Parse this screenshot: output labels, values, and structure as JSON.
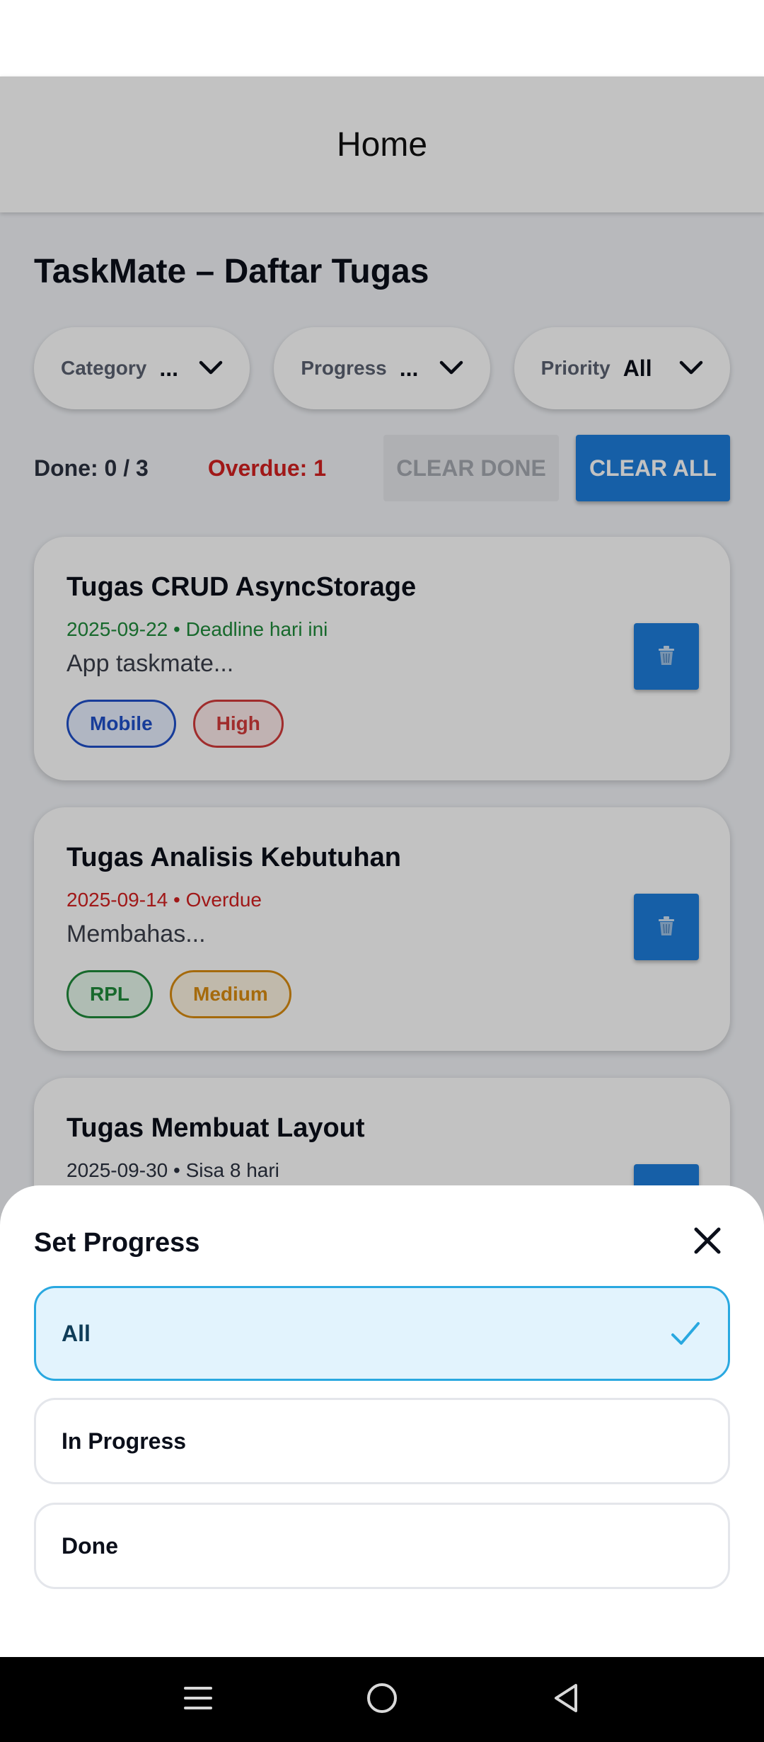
{
  "header": {
    "title": "Home"
  },
  "page": {
    "title": "TaskMate – Daftar Tugas"
  },
  "filters": [
    {
      "label": "Category",
      "value": "..."
    },
    {
      "label": "Progress",
      "value": "..."
    },
    {
      "label": "Priority",
      "value": "All"
    }
  ],
  "stats": {
    "done": "Done: 0 / 3",
    "overdue": "Overdue: 1",
    "clear_done_label": "CLEAR DONE",
    "clear_all_label": "CLEAR ALL"
  },
  "tasks": [
    {
      "title": "Tugas CRUD AsyncStorage",
      "meta": "2025-09-22 • Deadline hari ini",
      "meta_color": "#1f8a3b",
      "description": "App taskmate...",
      "tags": [
        {
          "label": "Mobile",
          "color": "#1f4fc9",
          "bg": "#e8efff"
        },
        {
          "label": "High",
          "color": "#d33a3a",
          "bg": "#fdeaea"
        }
      ]
    },
    {
      "title": "Tugas Analisis Kebutuhan",
      "meta": "2025-09-14 • Overdue",
      "meta_color": "#d32020",
      "description": "Membahas...",
      "tags": [
        {
          "label": "RPL",
          "color": "#1f8a3b",
          "bg": "#e7f7ec"
        },
        {
          "label": "Medium",
          "color": "#d98c10",
          "bg": "#fdf3e1"
        }
      ]
    },
    {
      "title": "Tugas Membuat Layout",
      "meta": "2025-09-30 • Sisa 8 hari",
      "meta_color": "#2b3140",
      "description": "",
      "tags": []
    }
  ],
  "sheet": {
    "title": "Set Progress",
    "options": [
      {
        "label": "All",
        "selected": true
      },
      {
        "label": "In Progress",
        "selected": false
      },
      {
        "label": "Done",
        "selected": false
      }
    ]
  },
  "colors": {
    "accent": "#1e7ddc",
    "selected_bg": "#e2f3fd",
    "selected_border": "#29a8e0",
    "overdue": "#d32020"
  },
  "icons": {
    "filter_chevron": "chevron-down-icon",
    "delete": "trash-icon",
    "close": "close-icon",
    "check": "check-icon",
    "nav": [
      "menu-icon",
      "home-circle-icon",
      "back-triangle-icon"
    ]
  }
}
